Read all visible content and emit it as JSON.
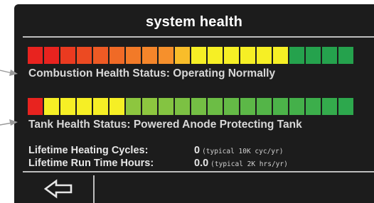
{
  "title": "system health",
  "combustion": {
    "status": "Combustion Health Status: Operating Normally",
    "segments": [
      "#e8231f",
      "#e8231f",
      "#ea3a20",
      "#ec4a22",
      "#ee5a24",
      "#f06a26",
      "#f27a28",
      "#f4852a",
      "#f6902c",
      "#f8bd2a",
      "#f6ef25",
      "#f6ef25",
      "#f6ef25",
      "#f6ef25",
      "#f6ef25",
      "#f6ef25",
      "#25a24d",
      "#25a24d",
      "#25a24d",
      "#25a24d"
    ]
  },
  "tank": {
    "status": "Tank Health Status: Powered Anode Protecting Tank",
    "segments": [
      "#e8231f",
      "#f6ef25",
      "#f6ef25",
      "#f6ef25",
      "#f6ef25",
      "#f6ef25",
      "#8dc63f",
      "#8dc63f",
      "#84c441",
      "#7cc143",
      "#74bf44",
      "#6cbd45",
      "#64ba46",
      "#5cb847",
      "#54b548",
      "#4cb349",
      "#44b04a",
      "#3cae4b",
      "#34ab4c",
      "#2da84d"
    ]
  },
  "stats": {
    "cycles_label": "Lifetime Heating Cycles:",
    "cycles_value": "0",
    "cycles_note": "(typical 10K cyc/yr)",
    "hours_label": "Lifetime Run Time Hours:",
    "hours_value": "0.0",
    "hours_note": "(typical 2K hrs/yr)"
  },
  "icons": {
    "back": "back-arrow-icon",
    "pointer": "pointer-arrow-icon"
  },
  "colors": {
    "screen_bg": "#1c1c1c",
    "rule": "#bdbdbd",
    "text": "#e6e6e6"
  }
}
